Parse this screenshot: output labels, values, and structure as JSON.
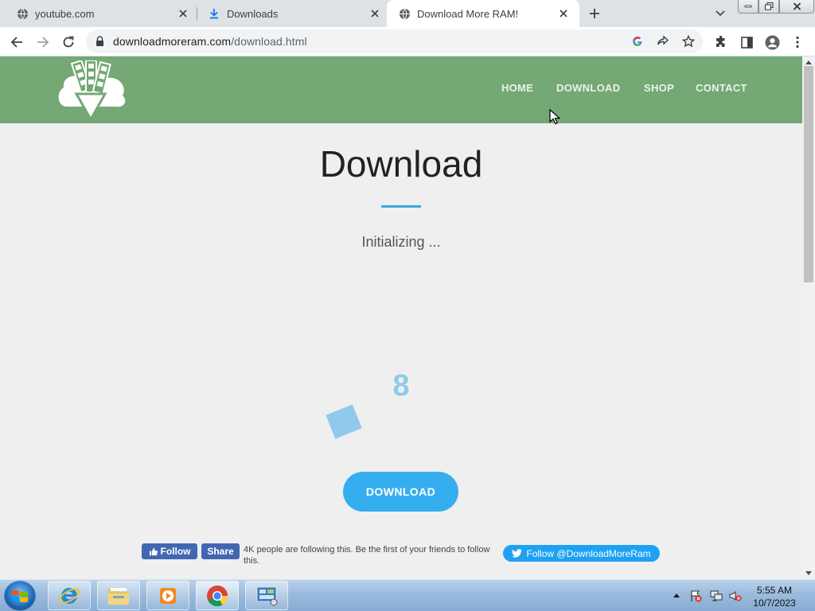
{
  "browser": {
    "tabs": [
      {
        "label": "youtube.com",
        "icon": "globe-icon",
        "active": false
      },
      {
        "label": "Downloads",
        "icon": "download-icon",
        "active": false
      },
      {
        "label": "Download More RAM!",
        "icon": "globe-icon",
        "active": true
      }
    ],
    "url_host": "downloadmoreram.com",
    "url_path": "/download.html"
  },
  "site": {
    "nav": [
      "HOME",
      "DOWNLOAD",
      "SHOP",
      "CONTACT"
    ],
    "title": "Download",
    "status": "Initializing ...",
    "countdown": "8",
    "download_button": "DOWNLOAD",
    "fb_follow": "Follow",
    "fb_share": "Share",
    "fb_text": "4K people are following this. Be the first of your friends to follow this.",
    "twitter_follow": "Follow @DownloadMoreRam"
  },
  "taskbar": {
    "time": "5:55 AM",
    "date": "10/7/2023"
  },
  "colors": {
    "header_green": "#74a874",
    "accent_blue": "#35aef0",
    "facebook_blue": "#4267b2",
    "twitter_blue": "#1da1f2"
  }
}
